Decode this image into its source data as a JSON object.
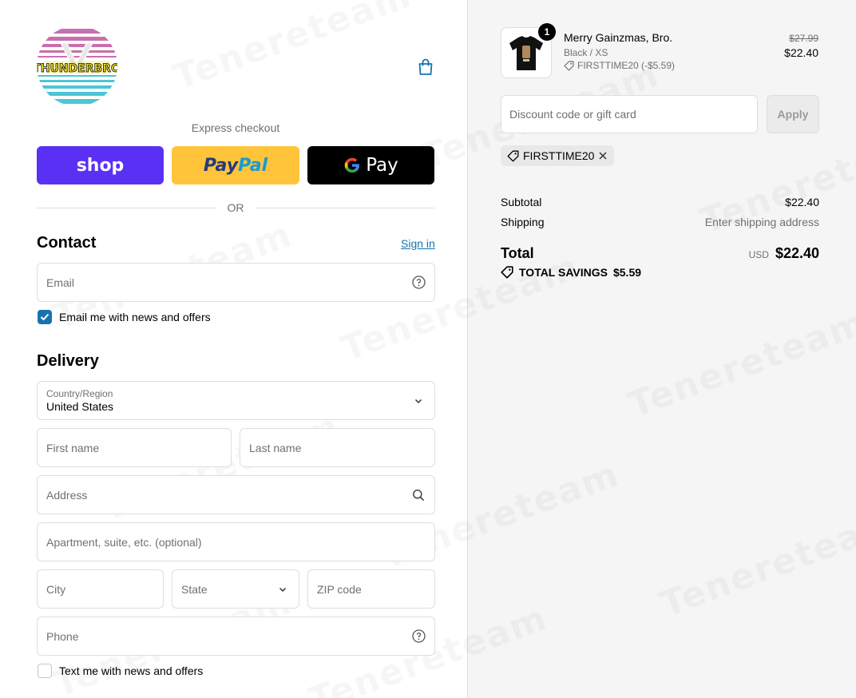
{
  "brand": {
    "logo_text": "THUNDERBRO"
  },
  "express": {
    "label": "Express checkout",
    "shop_label": "shop",
    "paypal_label_1": "Pay",
    "paypal_label_2": "Pal",
    "gpay_label": "Pay",
    "or_label": "OR"
  },
  "contact": {
    "heading": "Contact",
    "sign_in": "Sign in",
    "email_placeholder": "Email",
    "news_label": "Email me with news and offers",
    "news_checked": true
  },
  "delivery": {
    "heading": "Delivery",
    "country_label": "Country/Region",
    "country_value": "United States",
    "first_name": "First name",
    "last_name": "Last name",
    "address": "Address",
    "apartment": "Apartment, suite, etc. (optional)",
    "city": "City",
    "state": "State",
    "zip": "ZIP code",
    "phone": "Phone",
    "sms_label": "Text me with news and offers",
    "sms_checked": false
  },
  "order": {
    "qty": "1",
    "product_name": "Merry Gainzmas, Bro.",
    "variant": "Black / XS",
    "discount_line": "FIRSTTIME20 (-$5.59)",
    "price_old": "$27.99",
    "price_new": "$22.40"
  },
  "discount": {
    "placeholder": "Discount code or gift card",
    "apply_label": "Apply",
    "chip_code": "FIRSTTIME20"
  },
  "summary": {
    "subtotal_label": "Subtotal",
    "subtotal_value": "$22.40",
    "shipping_label": "Shipping",
    "shipping_value": "Enter shipping address",
    "total_label": "Total",
    "currency": "USD",
    "total_value": "$22.40",
    "savings_label": "TOTAL SAVINGS",
    "savings_value": "$5.59"
  },
  "colors": {
    "accent": "#1773b0",
    "shop_purple": "#5a31f4",
    "paypal_yellow": "#ffc439"
  }
}
